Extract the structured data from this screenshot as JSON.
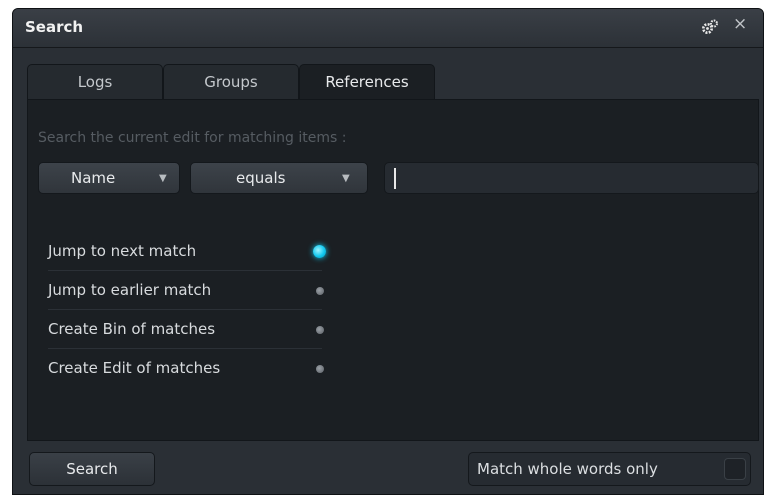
{
  "window": {
    "title": "Search",
    "icons": [
      "gear-icon",
      "close-icon"
    ],
    "close_glyph": "×"
  },
  "tabs": [
    {
      "label": "Logs",
      "active": false
    },
    {
      "label": "Groups",
      "active": false
    },
    {
      "label": "References",
      "active": true
    }
  ],
  "search": {
    "hint": "Search the current edit for matching items :",
    "field_dropdown": "Name",
    "operator_dropdown": "equals",
    "query_value": ""
  },
  "options": [
    {
      "label": "Jump to next match",
      "selected": true
    },
    {
      "label": "Jump to earlier match",
      "selected": false
    },
    {
      "label": "Create Bin of matches",
      "selected": false
    },
    {
      "label": "Create Edit of matches",
      "selected": false
    }
  ],
  "footer": {
    "search_button": "Search",
    "match_whole_words_label": "Match whole words only",
    "match_whole_words_checked": false
  },
  "colors": {
    "accent": "#11c8ef",
    "panel_bg": "#1b1f23",
    "window_bg": "#2a2f35"
  }
}
